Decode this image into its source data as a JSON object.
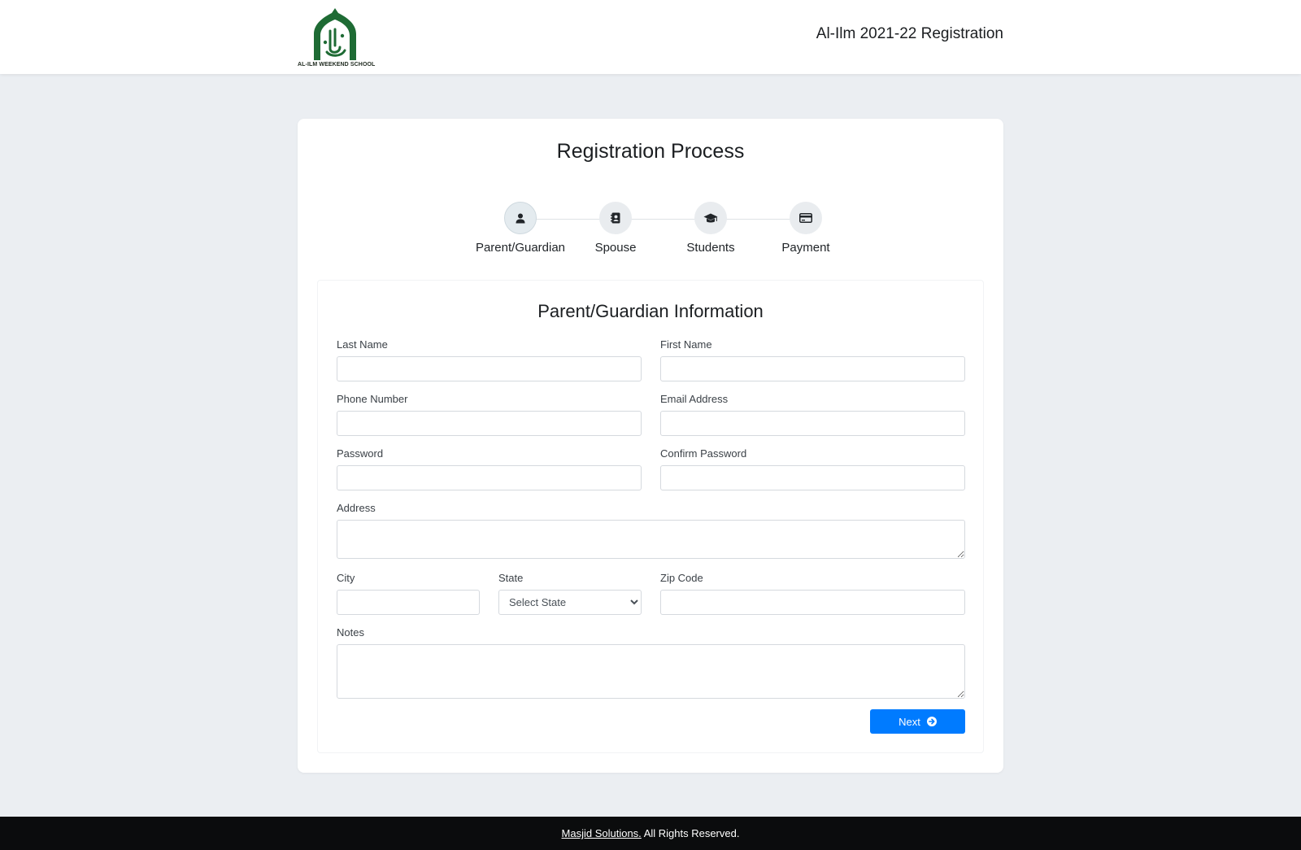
{
  "header": {
    "logo_text": "AL-ILM WEEKEND SCHOOL",
    "title": "Al-Ilm 2021-22 Registration",
    "logo_color": "#1e6b34"
  },
  "card": {
    "title": "Registration Process"
  },
  "steps": [
    {
      "label": "Parent/Guardian",
      "icon": "user-icon",
      "active": true
    },
    {
      "label": "Spouse",
      "icon": "address-book-icon",
      "active": false
    },
    {
      "label": "Students",
      "icon": "graduation-cap-icon",
      "active": false
    },
    {
      "label": "Payment",
      "icon": "credit-card-icon",
      "active": false
    }
  ],
  "form": {
    "title": "Parent/Guardian Information",
    "last_name": {
      "label": "Last Name",
      "value": ""
    },
    "first_name": {
      "label": "First Name",
      "value": ""
    },
    "phone": {
      "label": "Phone Number",
      "value": ""
    },
    "email": {
      "label": "Email Address",
      "value": ""
    },
    "password": {
      "label": "Password",
      "value": ""
    },
    "confirm_password": {
      "label": "Confirm Password",
      "value": ""
    },
    "address": {
      "label": "Address",
      "value": ""
    },
    "city": {
      "label": "City",
      "value": ""
    },
    "state": {
      "label": "State",
      "selected": "Select State"
    },
    "zip": {
      "label": "Zip Code",
      "value": ""
    },
    "notes": {
      "label": "Notes",
      "value": ""
    },
    "next_label": "Next"
  },
  "footer": {
    "link_text": "Masjid Solutions.",
    "rest_text": " All Rights Reserved."
  },
  "colors": {
    "primary": "#007bff",
    "page_bg": "#ebeef2",
    "footer_bg": "#0b0c0d"
  }
}
